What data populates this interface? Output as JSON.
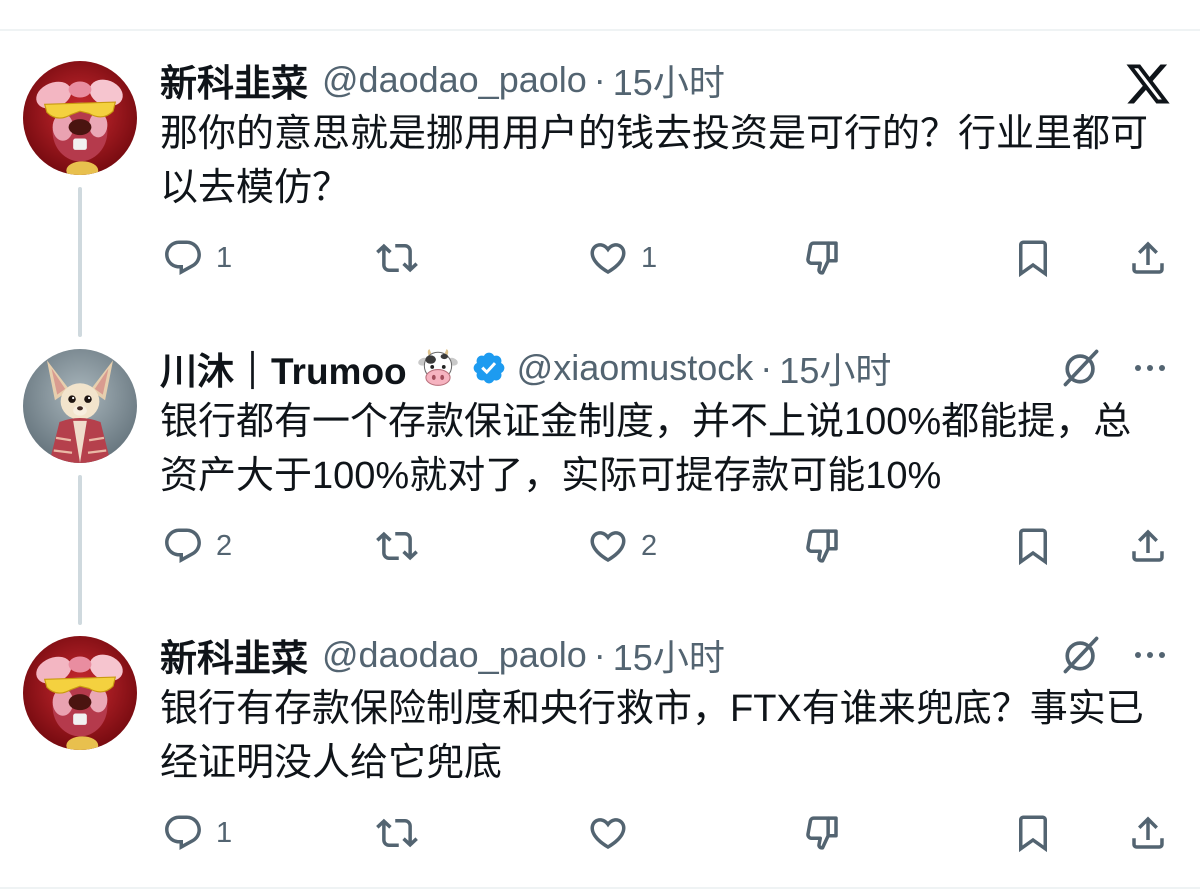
{
  "colors": {
    "text": "#0f1419",
    "muted": "#536471",
    "accent": "#1d9bf0",
    "thread_line": "#cfd9de",
    "divider": "#eff3f4"
  },
  "icons": {
    "logo": "x-logo-icon",
    "reply": "reply-icon",
    "retweet": "retweet-icon",
    "like": "heart-icon",
    "dislike": "thumbs-down-icon",
    "bookmark": "bookmark-icon",
    "share": "share-icon",
    "grok": "grok-icon",
    "more": "more-options-icon",
    "verified": "verified-badge-icon",
    "name_emoji": "cow-face-emoji-icon"
  },
  "tweets": [
    {
      "display_name": "新科韭菜",
      "handle": "@daodao_paolo",
      "separator": "·",
      "time": "15小时",
      "verified": false,
      "text_lines": [
        "那你的意思就是挪用用户的钱去投资是可行的？行业里都可",
        "以去模仿？"
      ],
      "reply_count": "1",
      "like_count": "1"
    },
    {
      "display_name": "川沐｜Trumoo",
      "handle": "@xiaomustock",
      "separator": "·",
      "time": "15小时",
      "verified": true,
      "text_lines": [
        "银行都有一个存款保证金制度，并不上说100%都能提，总",
        "资产大于100%就对了，实际可提存款可能10%"
      ],
      "reply_count": "2",
      "like_count": "2"
    },
    {
      "display_name": "新科韭菜",
      "handle": "@daodao_paolo",
      "separator": "·",
      "time": "15小时",
      "verified": false,
      "text_lines": [
        "银行有存款保险制度和央行救市，FTX有谁来兜底？事实已",
        "经证明没人给它兜底"
      ],
      "reply_count": "1"
    }
  ]
}
